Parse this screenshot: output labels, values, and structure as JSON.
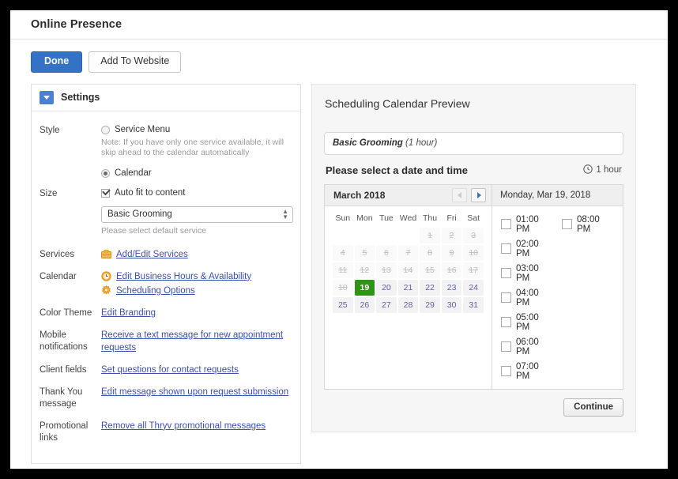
{
  "window": {
    "title": "Online Presence"
  },
  "toolbar": {
    "done_label": "Done",
    "add_to_website_label": "Add To Website"
  },
  "settings": {
    "header_label": "Settings",
    "style": {
      "label": "Style",
      "service_menu_label": "Service Menu",
      "service_menu_selected": false,
      "note": "Note: If you have only one service available, it will skip ahead to the calendar automatically",
      "calendar_label": "Calendar",
      "calendar_selected": true
    },
    "size": {
      "label": "Size",
      "autofit_label": "Auto fit to content",
      "autofit_checked": true,
      "service_select_value": "Basic Grooming",
      "service_select_options": [
        "Basic Grooming"
      ],
      "service_hint": "Please select default service"
    },
    "services": {
      "label": "Services",
      "link": "Add/Edit Services",
      "icon": "briefcase-icon"
    },
    "calendar": {
      "label": "Calendar",
      "link1": "Edit Business Hours & Availability",
      "icon1": "clock-icon",
      "link2": "Scheduling Options",
      "icon2": "gear-icon"
    },
    "color_theme": {
      "label": "Color Theme",
      "link": "Edit Branding"
    },
    "mobile_notifications": {
      "label": "Mobile notifications",
      "link": "Receive a text message for new appointment requests"
    },
    "client_fields": {
      "label": "Client fields",
      "link": "Set questions for contact requests"
    },
    "thank_you": {
      "label": "Thank You message",
      "link": "Edit message shown upon request submission"
    },
    "promotional_links": {
      "label": "Promotional links",
      "link": "Remove all Thryv promotional messages"
    }
  },
  "preview": {
    "title": "Scheduling Calendar Preview",
    "service_banner_name": "Basic Grooming",
    "service_banner_duration": "(1 hour)",
    "select_prompt": "Please select a date and time",
    "duration_label": "1 hour",
    "duration_icon": "clock-icon",
    "calendar": {
      "month_label": "March 2018",
      "prev_icon": "chevron-left-icon",
      "next_icon": "chevron-right-icon",
      "prev_disabled": true,
      "weekdays": [
        "Sun",
        "Mon",
        "Tue",
        "Wed",
        "Thu",
        "Fri",
        "Sat"
      ],
      "lead_blanks": 4,
      "days": [
        {
          "n": "1",
          "state": "past"
        },
        {
          "n": "2",
          "state": "past"
        },
        {
          "n": "3",
          "state": "past"
        },
        {
          "n": "4",
          "state": "past"
        },
        {
          "n": "5",
          "state": "past"
        },
        {
          "n": "6",
          "state": "past"
        },
        {
          "n": "7",
          "state": "past"
        },
        {
          "n": "8",
          "state": "past"
        },
        {
          "n": "9",
          "state": "past"
        },
        {
          "n": "10",
          "state": "past"
        },
        {
          "n": "11",
          "state": "past"
        },
        {
          "n": "12",
          "state": "past"
        },
        {
          "n": "13",
          "state": "past"
        },
        {
          "n": "14",
          "state": "past"
        },
        {
          "n": "15",
          "state": "past"
        },
        {
          "n": "16",
          "state": "past"
        },
        {
          "n": "17",
          "state": "past"
        },
        {
          "n": "18",
          "state": "past"
        },
        {
          "n": "19",
          "state": "selected"
        },
        {
          "n": "20",
          "state": "available"
        },
        {
          "n": "21",
          "state": "available"
        },
        {
          "n": "22",
          "state": "available"
        },
        {
          "n": "23",
          "state": "available"
        },
        {
          "n": "24",
          "state": "available"
        },
        {
          "n": "25",
          "state": "available"
        },
        {
          "n": "26",
          "state": "available"
        },
        {
          "n": "27",
          "state": "available"
        },
        {
          "n": "28",
          "state": "available"
        },
        {
          "n": "29",
          "state": "available"
        },
        {
          "n": "30",
          "state": "available"
        },
        {
          "n": "31",
          "state": "available"
        }
      ]
    },
    "slots": {
      "date_label": "Monday, Mar 19, 2018",
      "column1": [
        "01:00 PM",
        "02:00 PM",
        "03:00 PM",
        "04:00 PM",
        "05:00 PM",
        "06:00 PM",
        "07:00 PM"
      ],
      "column2": [
        "08:00 PM"
      ]
    },
    "continue_label": "Continue"
  },
  "colors": {
    "primary_button": "#3472c5",
    "selected_day": "#2e9416",
    "link": "#3e4fb0",
    "accent_icon": "#f0a030"
  }
}
